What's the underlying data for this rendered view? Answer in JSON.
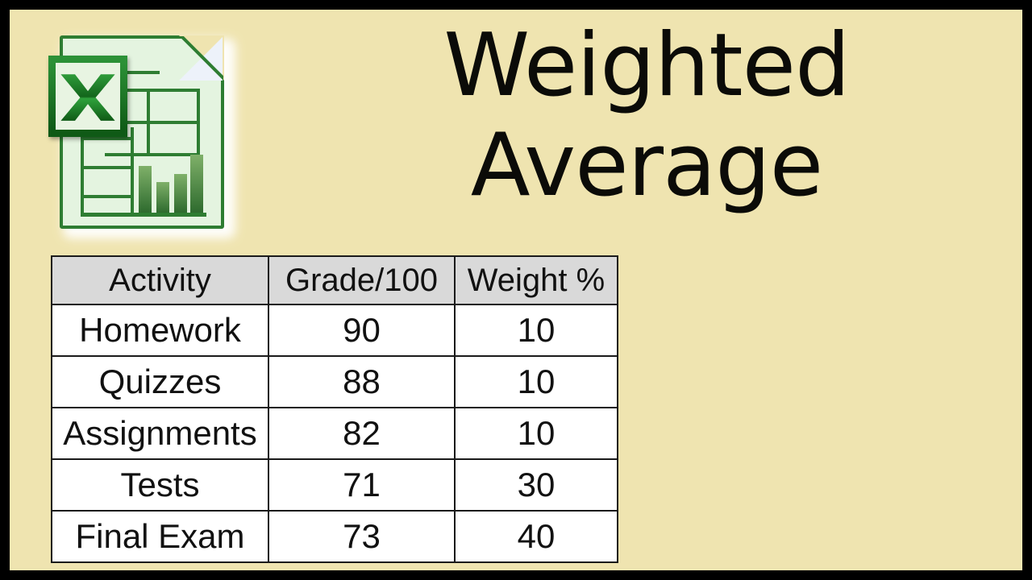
{
  "slide": {
    "background_color": "#EFE4B0",
    "border_color": "#000000",
    "title_line_1": "Weighted",
    "title_line_2": "Average"
  },
  "icon": {
    "name": "excel-document-icon",
    "letter": "X",
    "page_color": "#E4F4E0",
    "accent_color": "#2E7D32",
    "badge_color": "#1E8A2E",
    "chart_bars": [
      58,
      38,
      48,
      72
    ]
  },
  "table": {
    "headers": [
      "Activity",
      "Grade/100",
      "Weight %"
    ],
    "header_background": "#D9D9D9",
    "rows": [
      {
        "activity": "Homework",
        "grade": "90",
        "weight": "10"
      },
      {
        "activity": "Quizzes",
        "grade": "88",
        "weight": "10"
      },
      {
        "activity": "Assignments",
        "grade": "82",
        "weight": "10"
      },
      {
        "activity": "Tests",
        "grade": "71",
        "weight": "30"
      },
      {
        "activity": "Final Exam",
        "grade": "73",
        "weight": "40"
      }
    ]
  },
  "chart_data": {
    "type": "table",
    "title": "Weighted Average",
    "columns": [
      "Activity",
      "Grade/100",
      "Weight %"
    ],
    "categories": [
      "Homework",
      "Quizzes",
      "Assignments",
      "Tests",
      "Final Exam"
    ],
    "series": [
      {
        "name": "Grade/100",
        "values": [
          90,
          88,
          82,
          71,
          73
        ]
      },
      {
        "name": "Weight %",
        "values": [
          10,
          10,
          10,
          30,
          40
        ]
      }
    ],
    "xlabel": "Activity",
    "ylabel": ""
  }
}
